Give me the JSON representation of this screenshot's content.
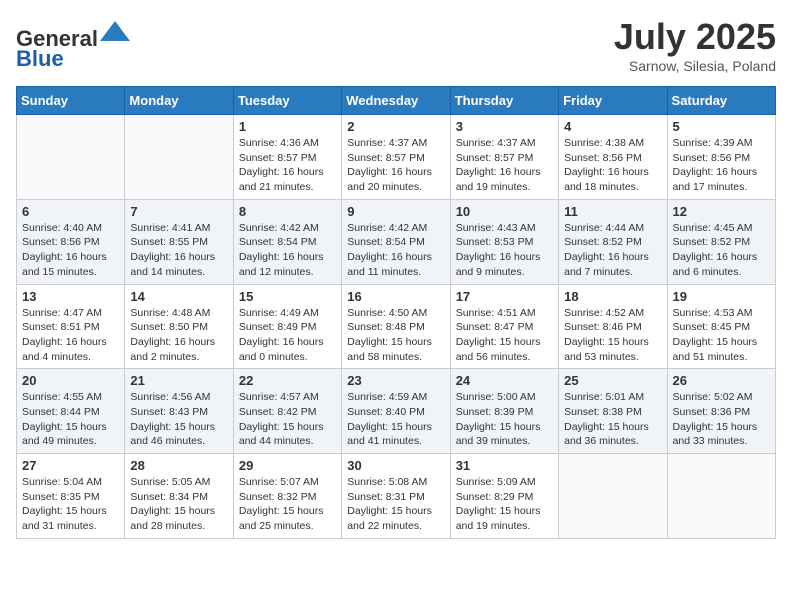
{
  "header": {
    "logo_general": "General",
    "logo_blue": "Blue",
    "month_title": "July 2025",
    "location": "Sarnow, Silesia, Poland"
  },
  "weekdays": [
    "Sunday",
    "Monday",
    "Tuesday",
    "Wednesday",
    "Thursday",
    "Friday",
    "Saturday"
  ],
  "weeks": [
    [
      {
        "day": "",
        "info": ""
      },
      {
        "day": "",
        "info": ""
      },
      {
        "day": "1",
        "info": "Sunrise: 4:36 AM\nSunset: 8:57 PM\nDaylight: 16 hours and 21 minutes."
      },
      {
        "day": "2",
        "info": "Sunrise: 4:37 AM\nSunset: 8:57 PM\nDaylight: 16 hours and 20 minutes."
      },
      {
        "day": "3",
        "info": "Sunrise: 4:37 AM\nSunset: 8:57 PM\nDaylight: 16 hours and 19 minutes."
      },
      {
        "day": "4",
        "info": "Sunrise: 4:38 AM\nSunset: 8:56 PM\nDaylight: 16 hours and 18 minutes."
      },
      {
        "day": "5",
        "info": "Sunrise: 4:39 AM\nSunset: 8:56 PM\nDaylight: 16 hours and 17 minutes."
      }
    ],
    [
      {
        "day": "6",
        "info": "Sunrise: 4:40 AM\nSunset: 8:56 PM\nDaylight: 16 hours and 15 minutes."
      },
      {
        "day": "7",
        "info": "Sunrise: 4:41 AM\nSunset: 8:55 PM\nDaylight: 16 hours and 14 minutes."
      },
      {
        "day": "8",
        "info": "Sunrise: 4:42 AM\nSunset: 8:54 PM\nDaylight: 16 hours and 12 minutes."
      },
      {
        "day": "9",
        "info": "Sunrise: 4:42 AM\nSunset: 8:54 PM\nDaylight: 16 hours and 11 minutes."
      },
      {
        "day": "10",
        "info": "Sunrise: 4:43 AM\nSunset: 8:53 PM\nDaylight: 16 hours and 9 minutes."
      },
      {
        "day": "11",
        "info": "Sunrise: 4:44 AM\nSunset: 8:52 PM\nDaylight: 16 hours and 7 minutes."
      },
      {
        "day": "12",
        "info": "Sunrise: 4:45 AM\nSunset: 8:52 PM\nDaylight: 16 hours and 6 minutes."
      }
    ],
    [
      {
        "day": "13",
        "info": "Sunrise: 4:47 AM\nSunset: 8:51 PM\nDaylight: 16 hours and 4 minutes."
      },
      {
        "day": "14",
        "info": "Sunrise: 4:48 AM\nSunset: 8:50 PM\nDaylight: 16 hours and 2 minutes."
      },
      {
        "day": "15",
        "info": "Sunrise: 4:49 AM\nSunset: 8:49 PM\nDaylight: 16 hours and 0 minutes."
      },
      {
        "day": "16",
        "info": "Sunrise: 4:50 AM\nSunset: 8:48 PM\nDaylight: 15 hours and 58 minutes."
      },
      {
        "day": "17",
        "info": "Sunrise: 4:51 AM\nSunset: 8:47 PM\nDaylight: 15 hours and 56 minutes."
      },
      {
        "day": "18",
        "info": "Sunrise: 4:52 AM\nSunset: 8:46 PM\nDaylight: 15 hours and 53 minutes."
      },
      {
        "day": "19",
        "info": "Sunrise: 4:53 AM\nSunset: 8:45 PM\nDaylight: 15 hours and 51 minutes."
      }
    ],
    [
      {
        "day": "20",
        "info": "Sunrise: 4:55 AM\nSunset: 8:44 PM\nDaylight: 15 hours and 49 minutes."
      },
      {
        "day": "21",
        "info": "Sunrise: 4:56 AM\nSunset: 8:43 PM\nDaylight: 15 hours and 46 minutes."
      },
      {
        "day": "22",
        "info": "Sunrise: 4:57 AM\nSunset: 8:42 PM\nDaylight: 15 hours and 44 minutes."
      },
      {
        "day": "23",
        "info": "Sunrise: 4:59 AM\nSunset: 8:40 PM\nDaylight: 15 hours and 41 minutes."
      },
      {
        "day": "24",
        "info": "Sunrise: 5:00 AM\nSunset: 8:39 PM\nDaylight: 15 hours and 39 minutes."
      },
      {
        "day": "25",
        "info": "Sunrise: 5:01 AM\nSunset: 8:38 PM\nDaylight: 15 hours and 36 minutes."
      },
      {
        "day": "26",
        "info": "Sunrise: 5:02 AM\nSunset: 8:36 PM\nDaylight: 15 hours and 33 minutes."
      }
    ],
    [
      {
        "day": "27",
        "info": "Sunrise: 5:04 AM\nSunset: 8:35 PM\nDaylight: 15 hours and 31 minutes."
      },
      {
        "day": "28",
        "info": "Sunrise: 5:05 AM\nSunset: 8:34 PM\nDaylight: 15 hours and 28 minutes."
      },
      {
        "day": "29",
        "info": "Sunrise: 5:07 AM\nSunset: 8:32 PM\nDaylight: 15 hours and 25 minutes."
      },
      {
        "day": "30",
        "info": "Sunrise: 5:08 AM\nSunset: 8:31 PM\nDaylight: 15 hours and 22 minutes."
      },
      {
        "day": "31",
        "info": "Sunrise: 5:09 AM\nSunset: 8:29 PM\nDaylight: 15 hours and 19 minutes."
      },
      {
        "day": "",
        "info": ""
      },
      {
        "day": "",
        "info": ""
      }
    ]
  ]
}
